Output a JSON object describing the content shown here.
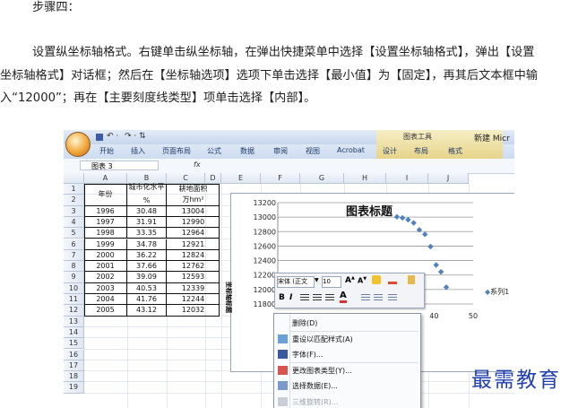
{
  "article": {
    "step_heading": "步骤四：",
    "para_line1": "设置纵坐标轴格式。右键单击纵坐标轴，在弹出快捷菜单中选择【设置坐标轴格式】，弹出【设置",
    "para_line2": "坐标轴格式】对话框；然后在【坐标轴选项】选项下单击选择【最小值】为【固定】，再其后文本框中输",
    "para_line3": "入“12000”；再在【主要刻度线类型】项单击选择【内部】。"
  },
  "excel": {
    "qa_undo": "↶ ·",
    "qa_redo": "↷ · ⇅",
    "ribbon_tabs": [
      "开始",
      "插入",
      "页面布局",
      "公式",
      "数据",
      "审阅",
      "视图",
      "Acrobat",
      "设计",
      "布局",
      "格式"
    ],
    "context_group": "图表工具",
    "window_title": "新建 Micr",
    "name_box": "图表 3",
    "fx": "fx",
    "columns": [
      "A",
      "B",
      "C",
      "D",
      "E",
      "F",
      "G",
      "H",
      "I",
      "J"
    ],
    "rows": [
      "1",
      "2",
      "3",
      "4",
      "5",
      "6",
      "7",
      "8",
      "9",
      "10",
      "11",
      "12",
      "13",
      "14",
      "15",
      "16",
      "17",
      "18",
      "19"
    ],
    "table": {
      "h_year": "年份",
      "h_urban": "城市化水平",
      "h_urban_unit": "%",
      "h_area": "耕地面积",
      "h_area_unit": "万hm²",
      "years": [
        "1996",
        "1997",
        "1998",
        "1999",
        "2000",
        "2001",
        "2002",
        "2003",
        "2004",
        "2005"
      ],
      "urban": [
        "30.48",
        "31.91",
        "33.35",
        "34.78",
        "36.22",
        "37.66",
        "39.09",
        "40.53",
        "41.76",
        "43.12"
      ],
      "area": [
        "13004",
        "12990",
        "12964",
        "12921",
        "12824",
        "12762",
        "12593",
        "12339",
        "12244",
        "12032"
      ]
    },
    "chart": {
      "title": "图表标题",
      "y_axis_title": "坐标轴标题",
      "y_ticks": [
        "13200",
        "13000",
        "12800",
        "12600",
        "12400",
        "12200",
        "12000",
        "11800"
      ],
      "x_ticks": [
        "40",
        "50"
      ],
      "legend": "系列1"
    },
    "chart_data": {
      "type": "scatter",
      "title": "图表标题",
      "ylabel": "坐标轴标题",
      "ylim": [
        11800,
        13200
      ],
      "series": [
        {
          "name": "系列1",
          "x": [
            30.48,
            31.91,
            33.35,
            34.78,
            36.22,
            37.66,
            39.09,
            40.53,
            41.76,
            43.12
          ],
          "y": [
            13004,
            12990,
            12964,
            12921,
            12824,
            12762,
            12593,
            12339,
            12244,
            12032
          ]
        }
      ]
    },
    "mini_toolbar": {
      "font": "宋体 (正文",
      "size": "10",
      "bold": "B",
      "italic": "I"
    },
    "context_menu": [
      "删除(D)",
      "重设以匹配样式(A)",
      "字体(F)...",
      "更改图表类型(Y)...",
      "选择数据(E)...",
      "三维旋转(R)..."
    ]
  },
  "watermark": "最需教育"
}
